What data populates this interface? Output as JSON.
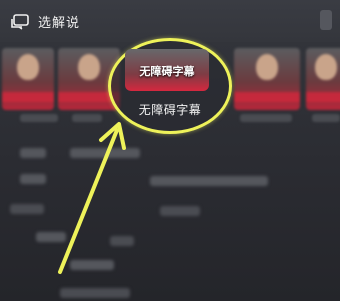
{
  "header": {
    "title": "选解说",
    "cast_icon": "cast-screen-icon"
  },
  "highlight": {
    "thumb_text": "无障碍字幕",
    "caption": "无障碍字幕"
  },
  "accent_color": "#eef25a"
}
